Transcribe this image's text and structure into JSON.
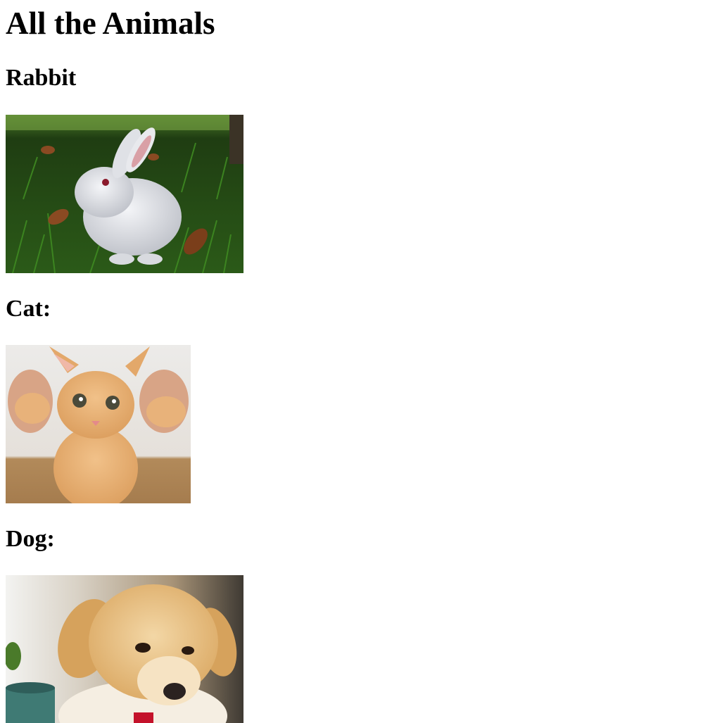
{
  "page": {
    "title": "All the Animals"
  },
  "sections": [
    {
      "heading": "Rabbit",
      "image": {
        "subject": "white rabbit in grass",
        "icon": "rabbit-photo"
      }
    },
    {
      "heading": "Cat:",
      "image": {
        "subject": "orange tabby kitten held by hands",
        "icon": "cat-photo"
      }
    },
    {
      "heading": "Dog:",
      "image": {
        "subject": "golden retriever puppy with red collar",
        "icon": "dog-photo"
      }
    }
  ],
  "colors": {
    "text": "#000000",
    "background": "#ffffff",
    "grass": "#2f6b1f",
    "rabbit_fur": "#e4e6ea",
    "kitten_fur": "#e3a86a",
    "puppy_fur": "#e9c48c",
    "collar": "#c4122a"
  }
}
